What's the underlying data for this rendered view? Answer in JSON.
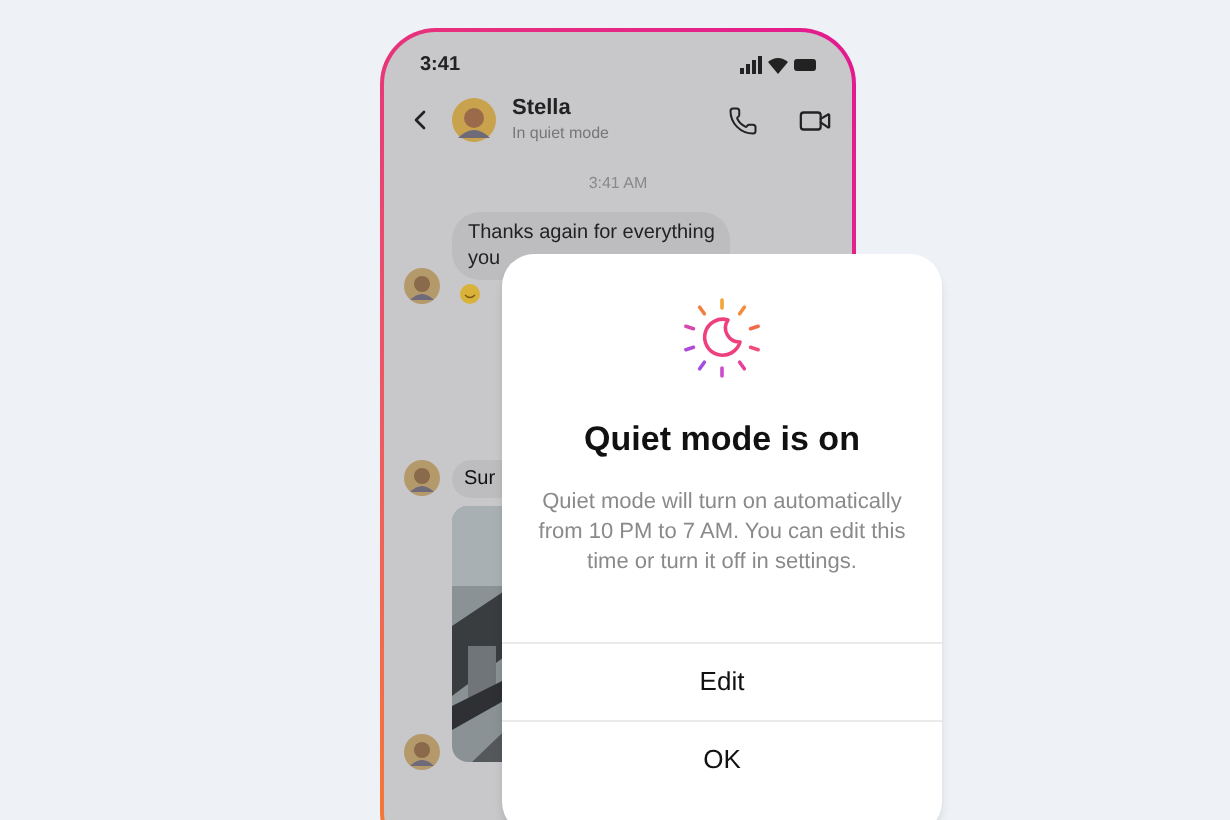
{
  "status_bar": {
    "time": "3:41"
  },
  "header": {
    "name": "Stella",
    "status": "In quiet mode"
  },
  "timestamp": "3:41 AM",
  "messages": [
    {
      "kind": "text",
      "lines": [
        "Thanks again for everything",
        "you"
      ],
      "reaction": true
    },
    {
      "lines": [
        "Sur"
      ]
    },
    {
      "kind": "avatar_only"
    }
  ],
  "dialog": {
    "title": "Quiet mode is on",
    "body": "Quiet mode will turn on automatically from 10 PM to 7 AM. You can edit this time or turn it off in settings.",
    "actions": [
      "Edit",
      "OK"
    ]
  }
}
